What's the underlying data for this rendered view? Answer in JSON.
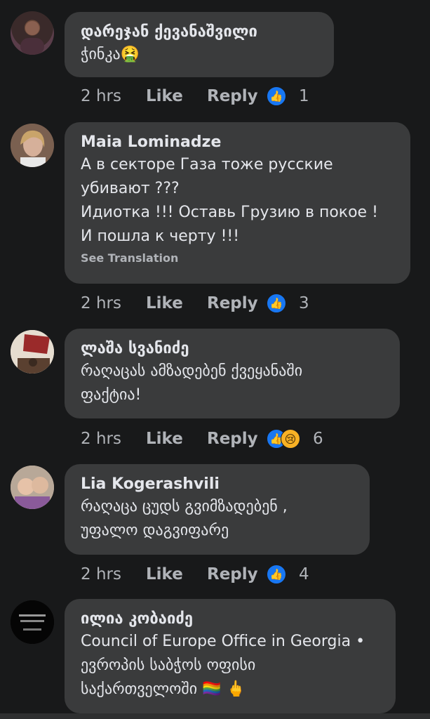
{
  "comments": [
    {
      "author": "დარეჯან ქევანაშვილი",
      "text": "ჭინკა",
      "emoji": "🤮",
      "time": "2 hrs",
      "like": "Like",
      "reply": "Reply",
      "reactions": "1",
      "avatar_icon": "profile-photo"
    },
    {
      "author": "Maia Lominadze",
      "text": "А в секторе Газа тоже русские\nубивают ???\nИдиотка !!!  Оставь Грузию в покое !\nИ пошла к черту !!!",
      "see_translation": "See Translation",
      "time": "2 hrs",
      "like": "Like",
      "reply": "Reply",
      "reactions": "3",
      "avatar_icon": "profile-photo"
    },
    {
      "author": "ლაშა სვანიძე",
      "text": "რაღაცას ამზადებენ ქვეყანაში\nფაქტია!",
      "time": "2 hrs",
      "like": "Like",
      "reply": "Reply",
      "reactions": "6",
      "avatar_icon": "profile-photo"
    },
    {
      "author": "Lia Kogerashvili",
      "text": "რაღაცა ცუდს გვიმზადებენ ,\nუფალო დაგვიფარე",
      "time": "2 hrs",
      "like": "Like",
      "reply": "Reply",
      "reactions": "4",
      "avatar_icon": "profile-photo"
    },
    {
      "author": "ილია კობაიძე",
      "text": "Council of Europe Office in Georgia •\nევროპის საბჭოს ოფისი\nსაქართველოში",
      "emoji": "🏳️‍🌈 🖕",
      "avatar_icon": "profile-photo"
    }
  ],
  "colors": {
    "background": "#18191a",
    "bubble": "#3a3b3c",
    "like_reaction": "#1877f2",
    "sad_reaction": "#f7b125",
    "secondary_text": "#b0b3b8"
  }
}
